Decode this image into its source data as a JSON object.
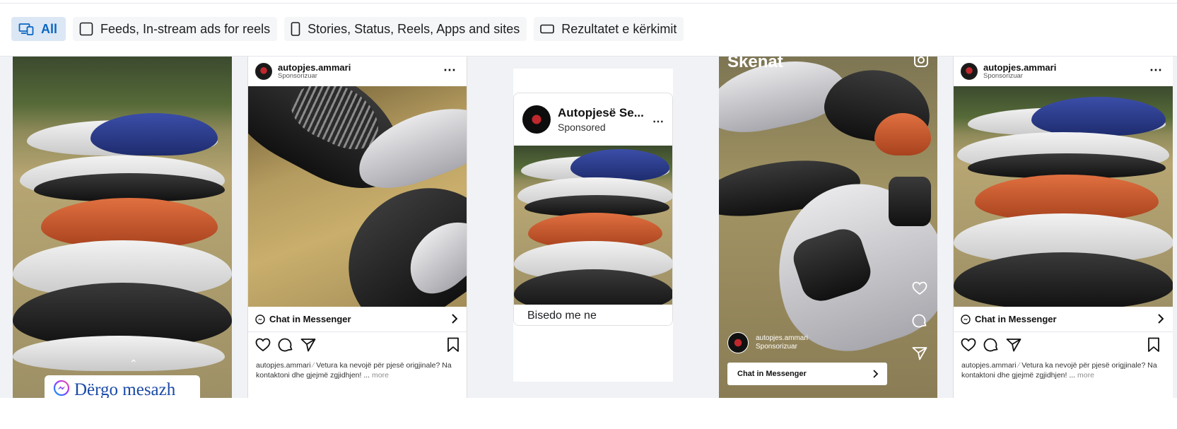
{
  "tabs": [
    {
      "label": "All",
      "icon": "devices-icon",
      "active": true
    },
    {
      "label": "Feeds, In-stream ads for reels",
      "icon": "square-icon",
      "active": false
    },
    {
      "label": "Stories, Status, Reels, Apps and sites",
      "icon": "phone-icon",
      "active": false
    },
    {
      "label": "Rezultatet e kërkimit",
      "icon": "wide-rect-icon",
      "active": false
    }
  ],
  "card1": {
    "cta_label": "Dërgo mesazh",
    "cta_icon": "messenger-icon"
  },
  "card2": {
    "account": "autopjes.ammari",
    "sponsored": "Sponsorizuar",
    "cta": "Chat in Messenger",
    "caption_user": "autopjes.ammari",
    "caption_text": "Vetura ka nevojë për pjesë origjinale? Na kontaktoni dhe gjejmë zgjidhjen! ...",
    "more": "more"
  },
  "card3": {
    "page_name": "Autopjesë Se...",
    "sponsored": "Sponsored",
    "cta": "Bisedo me ne"
  },
  "card4": {
    "overlay_text": "Skenat",
    "account": "autopjes.ammari",
    "sponsored": "Sponsorizuar",
    "cta": "Chat in Messenger"
  },
  "card5": {
    "account": "autopjes.ammari",
    "sponsored": "Sponsorizuar",
    "cta": "Chat in Messenger",
    "caption_user": "autopjes.ammari",
    "caption_text": "Vetura ka nevojë për pjesë origjinale? Na kontaktoni dhe gjejmë zgjidhjen! ...",
    "more": "more"
  },
  "colors": {
    "active_tab_bg": "#dbe7f5",
    "active_tab_text": "#0a66c2",
    "strip_bg": "#f0f2f5"
  }
}
